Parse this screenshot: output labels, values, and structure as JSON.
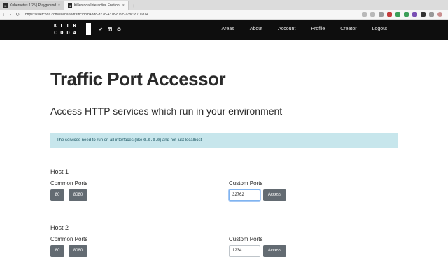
{
  "browser": {
    "tabs": [
      {
        "favicon": "K",
        "title": "Kubernetes 1.25 | Playground"
      },
      {
        "favicon": "K",
        "title": "Killercoda Interactive Environ..."
      }
    ],
    "new_tab": "+",
    "close": "×",
    "url": "https://killercoda.com/scenario/traffic/dbfb43d8-d77d-4378-879c-278c38706b14",
    "nav": {
      "back": "‹",
      "forward": "›",
      "reload": "↻"
    }
  },
  "header": {
    "logo_line1": "KLLR",
    "logo_line2": "CODA",
    "social_icons": [
      "twitter-icon",
      "linkedin-icon",
      "github-icon"
    ],
    "menu": [
      "Areas",
      "About",
      "Account",
      "Profile",
      "Creator",
      "Logout"
    ]
  },
  "main": {
    "title": "Traffic Port Accessor",
    "subtitle": "Access HTTP services which run in your environment",
    "notice_pre": "The services need to run on all interfaces (like ",
    "notice_code": "0.0.0.0",
    "notice_post": ") and not just localhost",
    "hosts": [
      {
        "name": "Host 1",
        "common_label": "Common Ports",
        "ports": [
          "80",
          "8080"
        ],
        "custom_label": "Custom Ports",
        "custom_value": "32762",
        "access_label": "Access"
      },
      {
        "name": "Host 2",
        "common_label": "Common Ports",
        "ports": [
          "80",
          "8080"
        ],
        "custom_label": "Custom Ports",
        "custom_value": "1234",
        "access_label": "Access"
      }
    ]
  },
  "colors": {
    "header_bg": "#0e0e0e",
    "notice_bg": "#c7e6ec",
    "button_bg": "#636b72"
  }
}
